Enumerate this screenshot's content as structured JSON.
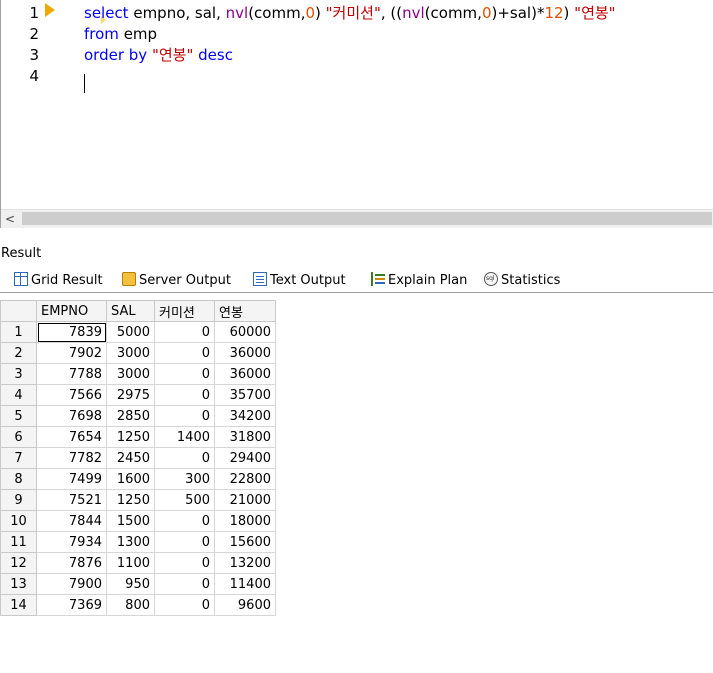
{
  "editor": {
    "line_numbers": [
      "1",
      "2",
      "3",
      "4"
    ],
    "line1": {
      "t1": "select",
      "t2": " empno, sal, ",
      "t3": "nvl",
      "t4": "(comm,",
      "t5": "0",
      "t6": ") ",
      "t7": "\"커미션\"",
      "t8": ", ((",
      "t9": "nvl",
      "t10": "(comm,",
      "t11": "0",
      "t12": ")+sal)*",
      "t13": "12",
      "t14": ") ",
      "t15": "\"연봉\""
    },
    "line2": {
      "t1": "from",
      "t2": " emp"
    },
    "line3": {
      "t1": "order by",
      "t2": " ",
      "t3": "\"연봉\"",
      "t4": " ",
      "t5": "desc"
    },
    "scroll_left": "<"
  },
  "result": {
    "title": "Result",
    "tabs": [
      {
        "label": "Grid Result",
        "icon": "grid-icon"
      },
      {
        "label": "Server Output",
        "icon": "server-output-icon"
      },
      {
        "label": "Text Output",
        "icon": "text-output-icon"
      },
      {
        "label": "Explain Plan",
        "icon": "explain-plan-icon"
      },
      {
        "label": "Statistics",
        "icon": "statistics-icon"
      }
    ],
    "columns": [
      "EMPNO",
      "SAL",
      "커미션",
      "연봉"
    ],
    "rows": [
      [
        "1",
        "7839",
        "5000",
        "0",
        "60000"
      ],
      [
        "2",
        "7902",
        "3000",
        "0",
        "36000"
      ],
      [
        "3",
        "7788",
        "3000",
        "0",
        "36000"
      ],
      [
        "4",
        "7566",
        "2975",
        "0",
        "35700"
      ],
      [
        "5",
        "7698",
        "2850",
        "0",
        "34200"
      ],
      [
        "6",
        "7654",
        "1250",
        "1400",
        "31800"
      ],
      [
        "7",
        "7782",
        "2450",
        "0",
        "29400"
      ],
      [
        "8",
        "7499",
        "1600",
        "300",
        "22800"
      ],
      [
        "9",
        "7521",
        "1250",
        "500",
        "21000"
      ],
      [
        "10",
        "7844",
        "1500",
        "0",
        "18000"
      ],
      [
        "11",
        "7934",
        "1300",
        "0",
        "15600"
      ],
      [
        "12",
        "7876",
        "1100",
        "0",
        "13200"
      ],
      [
        "13",
        "7900",
        "950",
        "0",
        "11400"
      ],
      [
        "14",
        "7369",
        "800",
        "0",
        "9600"
      ]
    ]
  }
}
